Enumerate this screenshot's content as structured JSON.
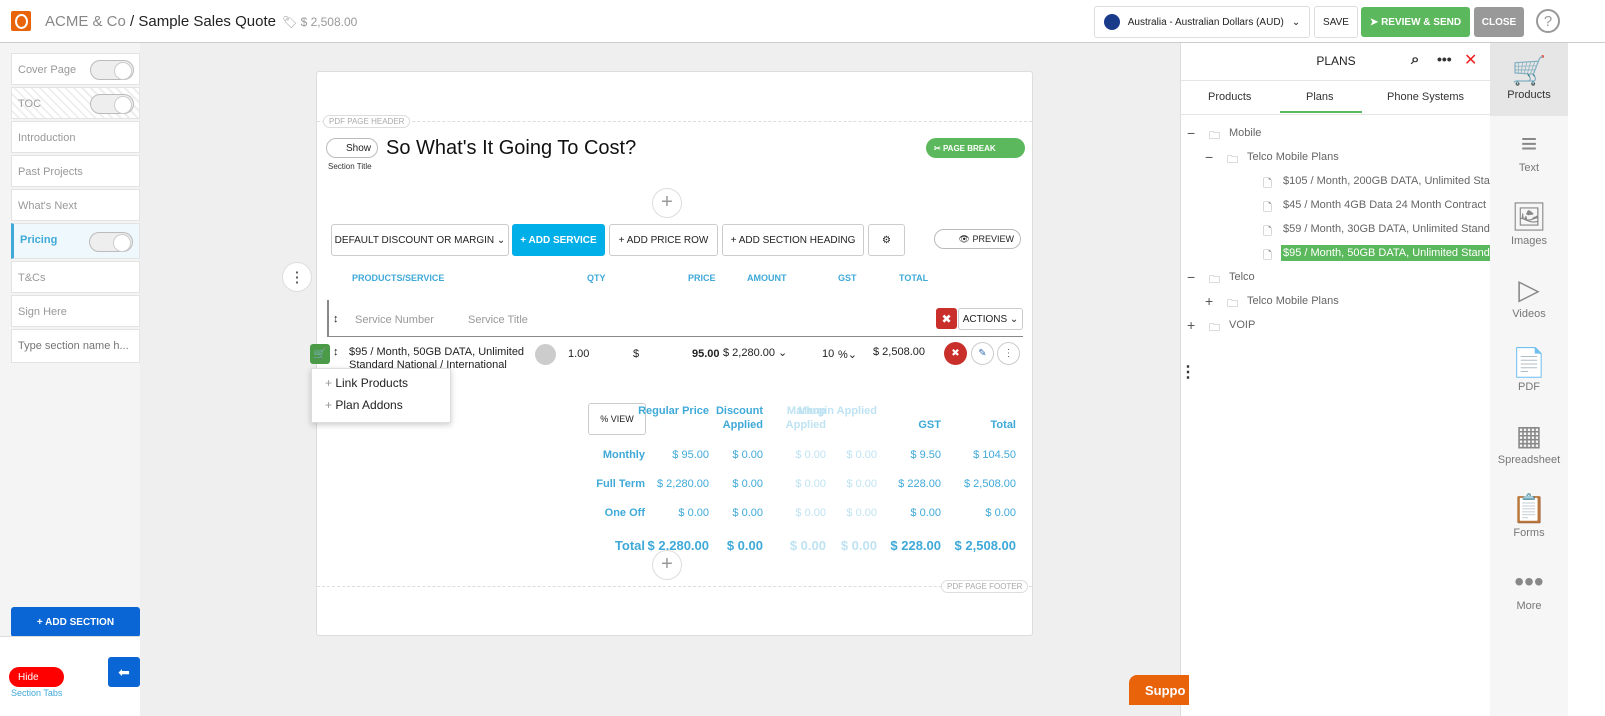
{
  "header": {
    "company": "ACME & Co",
    "separator": " / ",
    "doc_title": "Sample Sales Quote",
    "total": "$ 2,508.00",
    "currency": "Australia - Australian Dollars (AUD)",
    "save": "SAVE",
    "review": "REVIEW & SEND",
    "close": "CLOSE",
    "help": "?"
  },
  "sidebar": {
    "items": [
      {
        "label": "Cover Page"
      },
      {
        "label": "TOC"
      },
      {
        "label": "Introduction"
      },
      {
        "label": "Past Projects"
      },
      {
        "label": "What's Next"
      },
      {
        "label": "Pricing"
      },
      {
        "label": "T&Cs"
      },
      {
        "label": "Sign Here"
      }
    ],
    "new_placeholder": "Type section name h...",
    "add_section": "+ ADD SECTION",
    "hide": "Hide",
    "section_tabs": "Section Tabs"
  },
  "page": {
    "header_tag": "PDF PAGE HEADER",
    "footer_tag": "PDF PAGE FOOTER",
    "show": "Show",
    "section_title_label": "Section Title",
    "title": "So What's It Going To Cost?",
    "page_break": "PAGE BREAK",
    "toolbar": {
      "discount": "DEFAULT DISCOUNT OR MARGIN",
      "add_service": "+ ADD SERVICE",
      "add_price_row": "+ ADD PRICE ROW",
      "add_heading": "+ ADD SECTION HEADING",
      "preview": "PREVIEW"
    },
    "columns": [
      "PRODUCTS/SERVICE",
      "QTY",
      "PRICE",
      "AMOUNT",
      "GST",
      "TOTAL"
    ],
    "service_number": "Service Number",
    "service_title": "Service Title",
    "actions": "ACTIONS",
    "row": {
      "name": "$95 / Month, 50GB DATA, Unlimited Standard National / International Talk &",
      "qty": "1.00",
      "currency": "$",
      "price": "95.00",
      "amount": "$ 2,280.00",
      "gst": "10",
      "gst_unit": "%",
      "total": "$ 2,508.00"
    },
    "menu": [
      "Link Products",
      "Plan Addons"
    ],
    "summary": {
      "view": "% VIEW",
      "headers": [
        "Regular Price",
        "Discount Applied",
        "Markup Applied",
        "Margin Applied",
        "GST",
        "Total"
      ],
      "rows": [
        {
          "label": "Monthly",
          "values": [
            "$ 95.00",
            "$ 0.00",
            "$ 0.00",
            "$ 0.00",
            "$ 9.50",
            "$ 104.50"
          ]
        },
        {
          "label": "Full Term",
          "values": [
            "$ 2,280.00",
            "$ 0.00",
            "$ 0.00",
            "$ 0.00",
            "$ 228.00",
            "$ 2,508.00"
          ]
        },
        {
          "label": "One Off",
          "values": [
            "$ 0.00",
            "$ 0.00",
            "$ 0.00",
            "$ 0.00",
            "$ 0.00",
            "$ 0.00"
          ]
        },
        {
          "label": "Total",
          "values": [
            "$ 2,280.00",
            "$ 0.00",
            "$ 0.00",
            "$ 0.00",
            "$ 228.00",
            "$ 2,508.00"
          ]
        }
      ]
    }
  },
  "panel": {
    "title": "PLANS",
    "tabs": [
      "Products",
      "Plans",
      "Phone Systems"
    ],
    "active_tab": "Plans",
    "tree": [
      {
        "label": "Mobile",
        "level": 0,
        "type": "folder",
        "toggle": "−"
      },
      {
        "label": "Telco Mobile Plans",
        "level": 1,
        "type": "folder",
        "toggle": "−"
      },
      {
        "label": "$105 / Month, 200GB DATA, Unlimited Standa",
        "level": 2,
        "type": "file"
      },
      {
        "label": "$45 / Month 4GB Data 24 Month Contract",
        "level": 2,
        "type": "file"
      },
      {
        "label": "$59 / Month, 30GB DATA, Unlimited Standard",
        "level": 2,
        "type": "file"
      },
      {
        "label": "$95 / Month, 50GB DATA, Unlimited Standard",
        "level": 2,
        "type": "file",
        "selected": true
      },
      {
        "label": "Telco",
        "level": 0,
        "type": "folder",
        "toggle": "−"
      },
      {
        "label": "Telco Mobile Plans",
        "level": 1,
        "type": "folder",
        "toggle": "+"
      },
      {
        "label": "VOIP",
        "level": 0,
        "type": "folder",
        "toggle": "+"
      }
    ]
  },
  "rail": [
    {
      "label": "Products",
      "icon": "cart-icon"
    },
    {
      "label": "Text",
      "icon": "text-icon"
    },
    {
      "label": "Images",
      "icon": "image-icon"
    },
    {
      "label": "Videos",
      "icon": "play-icon"
    },
    {
      "label": "PDF",
      "icon": "pdf-icon"
    },
    {
      "label": "Spreadsheet",
      "icon": "table-icon"
    },
    {
      "label": "Forms",
      "icon": "form-icon"
    },
    {
      "label": "More",
      "icon": "more-icon"
    }
  ],
  "support": "Suppo",
  "colors": {
    "brand": "#e8630a",
    "green": "#5cb85c",
    "blue": "#0a66d4",
    "cyan": "#00aee8",
    "red": "#c9302c"
  }
}
